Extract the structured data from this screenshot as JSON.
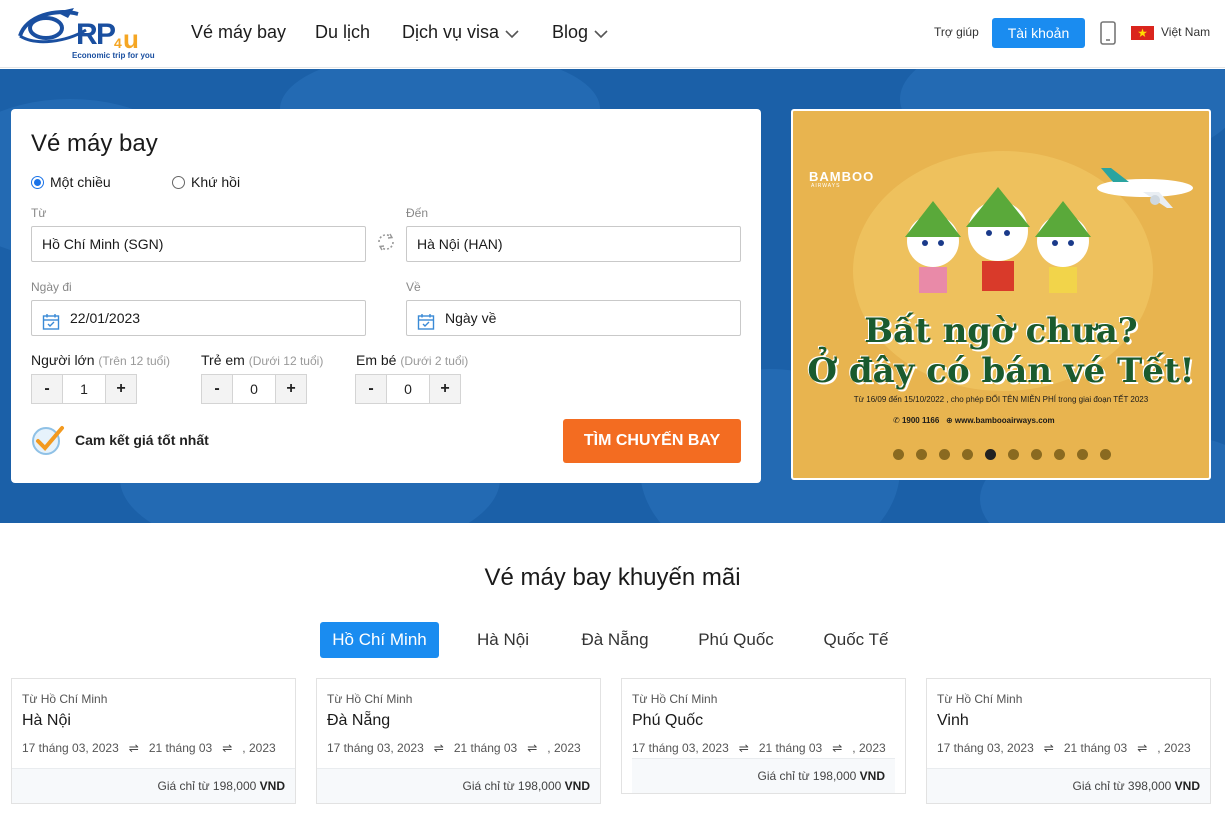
{
  "header": {
    "logo_text": "RP4U",
    "logo_slogan": "Economic trip for you",
    "nav": [
      {
        "label": "Vé máy bay"
      },
      {
        "label": "Du lịch"
      },
      {
        "label": "Dịch vụ visa"
      },
      {
        "label": "Blog"
      }
    ],
    "help": "Trợ giúp",
    "account": "Tài khoản",
    "language": "Việt Nam"
  },
  "search": {
    "title": "Vé máy bay",
    "trip_one_way": "Một chiều",
    "trip_round": "Khứ hồi",
    "from_label": "Từ",
    "from_value": "Hồ Chí Minh (SGN)",
    "to_label": "Đến",
    "to_value": "Hà Nội (HAN)",
    "depart_label": "Ngày đi",
    "depart_value": "22/01/2023",
    "return_label": "Về",
    "return_placeholder": "Ngày về",
    "adult_label": "Người lớn",
    "adult_sub": "(Trên 12 tuổi)",
    "adult_count": "1",
    "child_label": "Trẻ em",
    "child_sub": "(Dưới 12 tuổi)",
    "child_count": "0",
    "infant_label": "Em bé",
    "infant_sub": "(Dưới 2 tuổi)",
    "infant_count": "0",
    "minus": "-",
    "plus": "+",
    "commit": "Cam kết giá tốt nhất",
    "button": "TÌM CHUYẾN BAY"
  },
  "banner": {
    "brand": "BAMBOO",
    "brand_sub": "AIRWAYS",
    "headline1": "Bất ngờ chưa?",
    "headline2": "Ở đây có bán vé Tết!",
    "note": "Từ 16/09 đến 15/10/2022 , cho phép ĐỔI TÊN MIỄN PHÍ trong giai đoạn TẾT 2023",
    "phone": "1900 1166",
    "website": "www.bambooairways.com",
    "slide_count": 10,
    "active_slide": 5
  },
  "promo": {
    "title": "Vé máy bay khuyến mãi",
    "tabs": [
      "Hồ Chí Minh",
      "Hà Nội",
      "Đà Nẵng",
      "Phú Quốc",
      "Quốc Tế"
    ],
    "cards": [
      {
        "from": "Từ Hồ Chí Minh",
        "to": "Hà Nội",
        "date1": "17 tháng 03, 2023",
        "date2": "21 tháng 03",
        "date3": ", 2023",
        "price_prefix": "Giá chỉ từ 198,000",
        "currency": "VND"
      },
      {
        "from": "Từ Hồ Chí Minh",
        "to": "Đà Nẵng",
        "date1": "17 tháng 03, 2023",
        "date2": "21 tháng 03",
        "date3": ", 2023",
        "price_prefix": "Giá chỉ từ 198,000",
        "currency": "VND"
      },
      {
        "from": "Từ Hồ Chí Minh",
        "to": "Phú Quốc",
        "date1": "17 tháng 03, 2023",
        "date2": "21 tháng 03",
        "date3": ", 2023",
        "price_prefix": "Giá chỉ từ 198,000",
        "currency": "VND"
      },
      {
        "from": "Từ Hồ Chí Minh",
        "to": "Vinh",
        "date1": "17 tháng 03, 2023",
        "date2": "21 tháng 03",
        "date3": ", 2023",
        "price_prefix": "Giá chỉ từ 398,000",
        "currency": "VND"
      }
    ]
  },
  "colors": {
    "primary": "#1a8cf0",
    "hero_bg": "#1b60a8",
    "cta": "#f36c21"
  }
}
